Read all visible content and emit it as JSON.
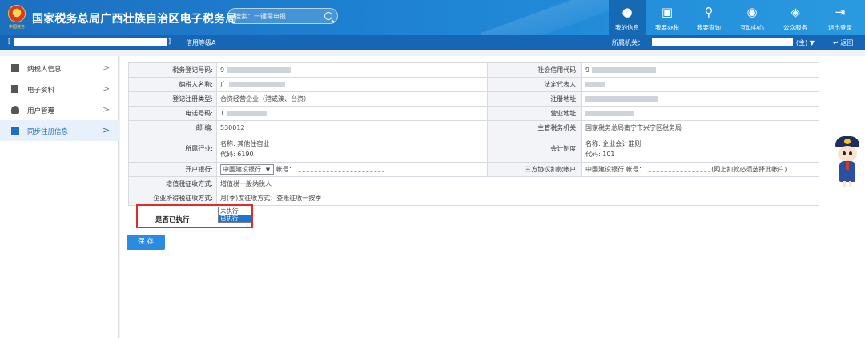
{
  "header": {
    "brand": "国家税务总局广西壮族自治区电子税务局",
    "emblem_text": "中国税务",
    "search_placeholder": "搜索：一键零申报",
    "nav": [
      {
        "label": "我的信息",
        "icon": "user-icon",
        "glyph": "👤",
        "active": true
      },
      {
        "label": "我要办税",
        "icon": "monitor-icon",
        "glyph": "🖥",
        "active": false
      },
      {
        "label": "我要查询",
        "icon": "document-search-icon",
        "glyph": "🔍",
        "active": false
      },
      {
        "label": "互动中心",
        "icon": "chat-icon",
        "glyph": "💬",
        "active": false
      },
      {
        "label": "公众服务",
        "icon": "service-icon",
        "glyph": "🛡",
        "active": false
      },
      {
        "label": "退出登录",
        "icon": "logout-icon",
        "glyph": "⇥",
        "active": false
      }
    ]
  },
  "subbar": {
    "bracket_open": "[",
    "bracket_close": "]",
    "credit_rating": "信用等级A",
    "org_label": "所属机关：",
    "org_suffix": "(主) ▼",
    "back": "返回"
  },
  "sidebar": {
    "items": [
      {
        "label": "纳税人信息",
        "icon": "list-icon",
        "active": false
      },
      {
        "label": "电子资料",
        "icon": "file-icon",
        "active": false
      },
      {
        "label": "用户管理",
        "icon": "user-manage-icon",
        "active": false
      },
      {
        "label": "同步注册信息",
        "icon": "chart-icon",
        "active": true
      }
    ],
    "arrow": ">"
  },
  "form": {
    "tax_reg_no": {
      "label": "税务登记号码:",
      "prefix": "9"
    },
    "social_credit": {
      "label": "社会信用代码:",
      "prefix": "9"
    },
    "taxpayer_name": {
      "label": "纳税人名称:",
      "prefix": "广"
    },
    "legal_rep": {
      "label": "法定代表人:"
    },
    "reg_type": {
      "label": "登记注册类型:",
      "value": "合资经营企业（港或澳、台资）"
    },
    "reg_address": {
      "label": "注册地址:"
    },
    "phone": {
      "label": "电话号码:",
      "prefix": "1"
    },
    "biz_address": {
      "label": "营业地址:"
    },
    "postcode": {
      "label": "邮 编:",
      "value": "530012"
    },
    "tax_authority": {
      "label": "主管税务机关:",
      "value": "国家税务总局南宁市兴宁区税务局"
    },
    "industry": {
      "label": "所属行业:",
      "name": "名称: 其他住宿业",
      "code": "代码: 6190"
    },
    "accounting": {
      "label": "会计制度:",
      "name": "名称: 企业会计准则",
      "code": "代码: 101"
    },
    "bank": {
      "label": "开户银行:",
      "selected": "中国建设银行",
      "acct_label": "帐号："
    },
    "tripartite": {
      "label": "三方协议扣款帐户:",
      "bank": "中国建设银行",
      "acct_label": "帐号：",
      "note": "(网上扣款必须选择此帐户)"
    },
    "vat_method": {
      "label": "增值税征收方式:",
      "value": "增值税一般纳税人"
    },
    "cit_method": {
      "label": "企业所得税征收方式:",
      "value": "月(季)度征收方式：查账征收一按季"
    },
    "executed": {
      "label": "是否已执行",
      "options": [
        "未执行",
        "已执行"
      ],
      "selected": "已执行"
    }
  },
  "actions": {
    "save": "保 存"
  },
  "colors": {
    "header": "#1f86d6",
    "subbar": "#1766b5",
    "accent": "#2a8be0",
    "highlight_box": "#e02b2b"
  }
}
